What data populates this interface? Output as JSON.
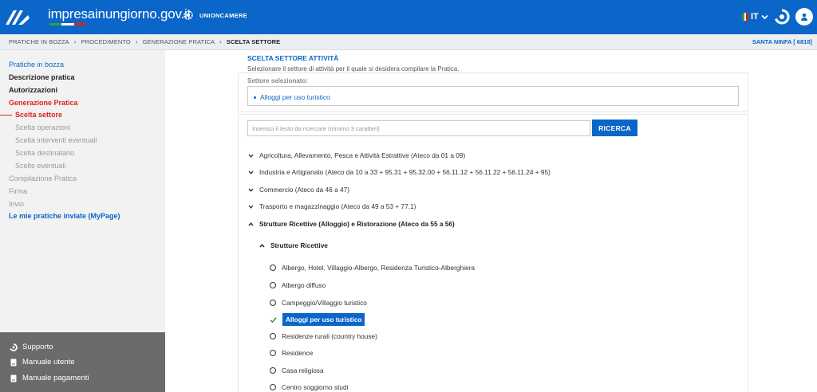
{
  "header": {
    "brand": "impresainungiorno.gov.it",
    "partner": "UNIONCAMERE",
    "language": "IT",
    "icons": [
      "logo-icon",
      "unioncamere-gear-icon",
      "italy-flag-icon",
      "chevron-down-icon",
      "support-icon",
      "user-icon"
    ],
    "accent_color": "#0a66c8"
  },
  "breadcrumb": {
    "items": [
      "PRATICHE IN BOZZA",
      "PROCEDIMENTO",
      "GENERAZIONE PRATICA",
      "SCELTA SETTORE"
    ],
    "separator": "›",
    "municipality": "SANTA NINFA [ 6818]"
  },
  "sidebar": {
    "items": [
      "Pratiche in bozza",
      "Descrizione pratica",
      "Autorizzazioni",
      "Generazione Pratica",
      "Scelta settore",
      "Scelta operazioni",
      "Scelta interventi eventuali",
      "Scelta destinatario",
      "Scelte eventuali",
      "Compilazione Pratica",
      "Firma",
      "Invio",
      "Le mie pratiche inviate (MyPage)"
    ],
    "support": [
      "Supporto",
      "Manuale utente",
      "Manuale pagamenti"
    ]
  },
  "main": {
    "title": "SCELTA SETTORE ATTIVITÀ",
    "subtitle": "Selezionare il settore di attività per il quale si desidera compilare la Pratica.",
    "selected_label": "Settore selezionato:",
    "selected_value": "Alloggi per uso turistico",
    "search_placeholder": "Inserisci il testo da ricercare (minimo 3 caratteri)",
    "search_button": "RICERCA",
    "sectors": [
      "Agricoltura, Allevamento, Pesca e Attività Estrattive (Ateco da 01 a 09)",
      "Industria e Artigianato (Ateco da 10 a 33 + 95.31 + 95.32.00 + 56.11.12 + 56.11.22 + 56.11.24 + 95)",
      "Commercio (Ateco da 46 a 47)",
      "Trasporto e magazzinaggio (Ateco da 49 a 53 + 77.1)",
      "Strutture Ricettive (Alloggio) e Ristorazione (Ateco da 55 a 56)"
    ],
    "subsector": "Strutture Ricettive",
    "options": [
      "Albergo, Hotel, Villaggio-Albergo, Residenza Turistico-Alberghiera",
      "Albergo diffuso",
      "Campeggio/Villaggio turistico",
      "Alloggi per uso turistico",
      "Residenze rurali (country house)",
      "Residence",
      "Casa religiosa",
      "Centro soggiorno studi"
    ],
    "selected_option_index": 3
  }
}
